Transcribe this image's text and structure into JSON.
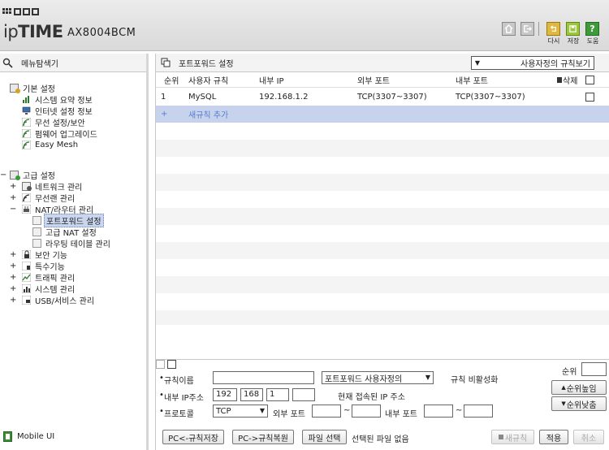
{
  "header": {
    "brand": "ipTIME",
    "model": "AX8004BCM",
    "buttons": [
      {
        "name": "home",
        "label": ""
      },
      {
        "name": "logout",
        "label": ""
      },
      {
        "name": "redo",
        "label": "다시"
      },
      {
        "name": "save",
        "label": "저장"
      },
      {
        "name": "help",
        "label": "도움"
      }
    ]
  },
  "sidebar": {
    "title": "메뉴탐색기",
    "basic_title": "기본 설정",
    "basic_items": [
      "시스템 요약 정보",
      "인터넷 설정 정보",
      "무선 설정/보안",
      "펌웨어 업그레이드",
      "Easy Mesh"
    ],
    "advanced_title": "고급 설정",
    "advanced_items": [
      "네트워크 관리",
      "무선랜 관리",
      "NAT/라우터 관리"
    ],
    "nat_items": [
      "포트포워드 설정",
      "고급 NAT 설정",
      "라우팅 테이블 관리"
    ],
    "more_items": [
      "보안 기능",
      "특수기능",
      "트래픽 관리",
      "시스템 관리",
      "USB/서비스 관리"
    ],
    "mobile": "Mobile UI"
  },
  "main": {
    "title": "포트포워드 설정",
    "view_select": "사용자정의 규칙보기",
    "columns": {
      "no": "순위",
      "name": "사용자 규칙",
      "ip": "내부 IP",
      "ext": "외부 포트",
      "int": "내부 포트",
      "del": "삭제"
    },
    "rows": [
      {
        "no": "1",
        "name": "MySQL",
        "ip": "192.168.1.2",
        "ext": "TCP(3307~3307)",
        "int": "TCP(3307~3307)"
      }
    ],
    "add_rule": "새규칙 추가",
    "add_symbol": "+"
  },
  "form": {
    "rank_label": "순위",
    "rule_name_label": "규칙이름",
    "rule_name_value": "",
    "preset_select": "포트포워드 사용자정의",
    "disable_label": "규칙 비활성화",
    "ip_label": "내부 IP주소",
    "ip": [
      "192",
      "168",
      "1",
      ""
    ],
    "current_ip_label": "현재 접속된 IP 주소",
    "protocol_label": "프로토콜",
    "protocol": "TCP",
    "ext_port_label": "외부 포트",
    "int_port_label": "내부 포트",
    "tilde": "~",
    "rank_up": "순위높임",
    "rank_down": "순위낮춤",
    "pc_save": "PC<-규칙저장",
    "pc_restore": "PC->규칙복원",
    "file_select": "파일 선택",
    "no_file": "선택된 파일 없음",
    "new_rule": "새규칙",
    "apply": "적용",
    "cancel": "취소"
  }
}
